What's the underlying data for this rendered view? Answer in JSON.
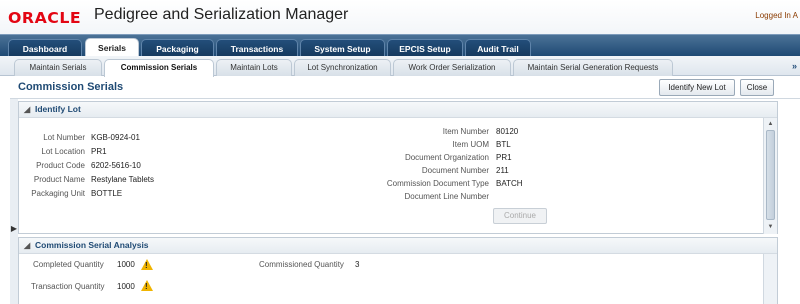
{
  "header": {
    "logo": "ORACLE",
    "app_title": "Pedigree and Serialization Manager",
    "logged_in": "Logged In A"
  },
  "main_nav": {
    "tabs": [
      "Dashboard",
      "Serials",
      "Packaging",
      "Transactions",
      "System Setup",
      "EPCIS Setup",
      "Audit Trail"
    ],
    "active": "Serials"
  },
  "sub_nav": {
    "tabs": [
      "Maintain Serials",
      "Commission Serials",
      "Maintain Lots",
      "Lot Synchronization",
      "Work Order Serialization",
      "Maintain Serial Generation Requests"
    ],
    "active": "Commission Serials",
    "overflow": "»"
  },
  "page": {
    "title": "Commission Serials",
    "identify_button": "Identify New Lot",
    "close_button": "Close"
  },
  "identify_lot": {
    "title": "Identify Lot",
    "left_fields": [
      {
        "label": "Lot Number",
        "value": "KGB-0924-01"
      },
      {
        "label": "Lot Location",
        "value": "PR1"
      },
      {
        "label": "Product Code",
        "value": "6202-5616-10"
      },
      {
        "label": "Product Name",
        "value": "Restylane Tablets"
      },
      {
        "label": "Packaging Unit",
        "value": "BOTTLE"
      }
    ],
    "right_fields": [
      {
        "label": "Item Number",
        "value": "80120"
      },
      {
        "label": "Item UOM",
        "value": "BTL"
      },
      {
        "label": "Document Organization",
        "value": "PR1"
      },
      {
        "label": "Document Number",
        "value": "211"
      },
      {
        "label": "Commission Document Type",
        "value": "BATCH"
      },
      {
        "label": "Document Line Number",
        "value": ""
      }
    ],
    "continue_button": "Continue"
  },
  "analysis": {
    "title": "Commission Serial Analysis",
    "completed_label": "Completed Quantity",
    "completed_value": "1000",
    "commissioned_label": "Commissioned Quantity",
    "commissioned_value": "3",
    "transaction_label": "Transaction Quantity",
    "transaction_value": "1000"
  },
  "colors": {
    "brand": "#e30613",
    "nav": "#1f4a74",
    "warning": "#f0b400"
  }
}
